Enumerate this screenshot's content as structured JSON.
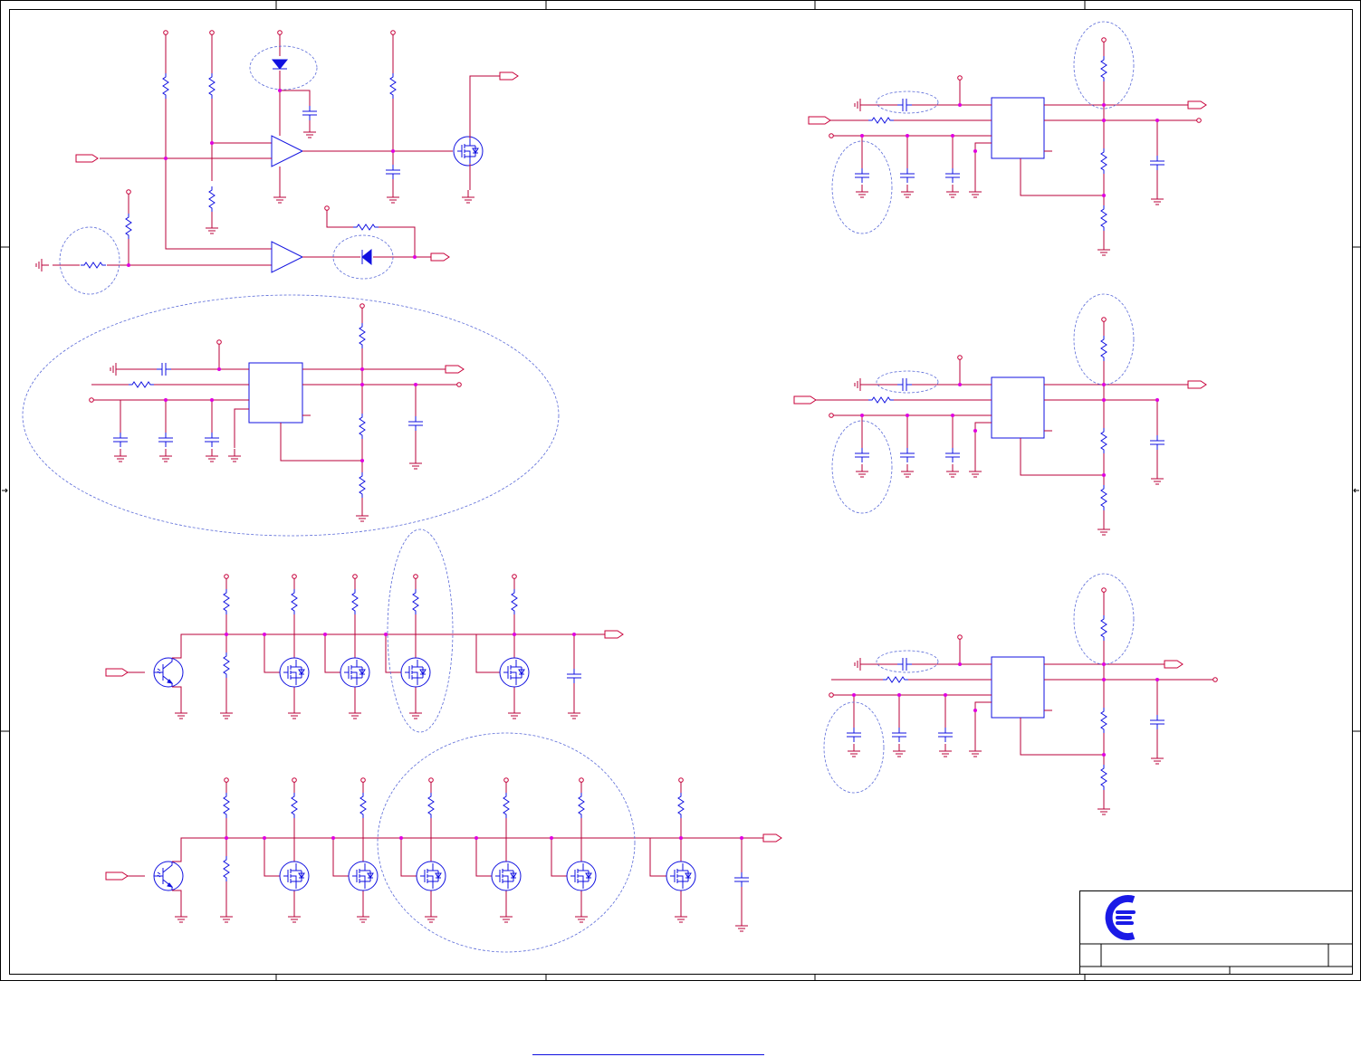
{
  "colors": {
    "wire": "#b8003a",
    "component": "#1010e0",
    "junction": "#e000e0",
    "highlight": "#5a6ad8",
    "frame": "#000000",
    "logo": "#1a1ae6"
  },
  "icons": {
    "logo": "company-logo-icon",
    "mosfet": "mosfet-icon",
    "bjt": "npn-transistor-icon",
    "opamp": "comparator-icon",
    "diode": "diode-icon",
    "resistor": "resistor-icon",
    "capacitor": "capacitor-icon",
    "ground": "ground-icon",
    "port": "net-port-icon"
  },
  "footer": {
    "link_text": ""
  }
}
